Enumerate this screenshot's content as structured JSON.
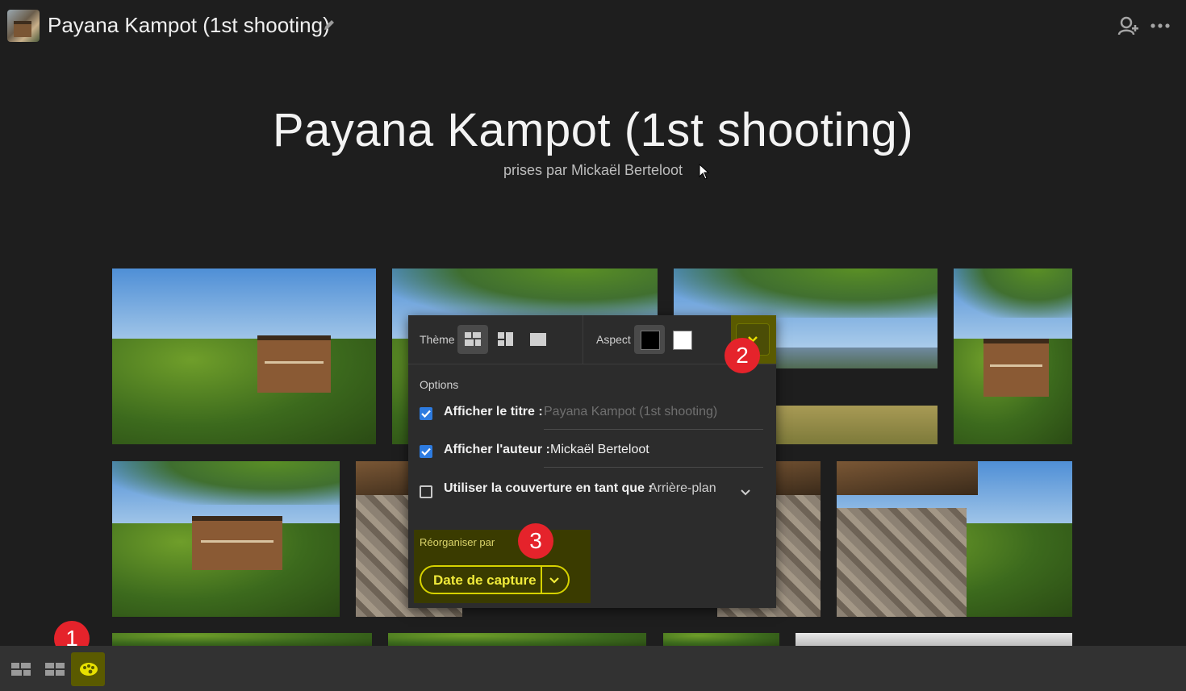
{
  "header": {
    "album_title": "Payana Kampot (1st shooting)",
    "edit_icon": "pencil-icon",
    "share_icon": "add-person-icon",
    "more_icon": "more-icon"
  },
  "hero": {
    "title": "Payana Kampot (1st shooting)",
    "subtitle": "prises par Mickaël Berteloot"
  },
  "popup": {
    "theme_label": "Thème",
    "aspect_label": "Aspect",
    "aspect_options": [
      {
        "name": "black",
        "color": "#000000"
      },
      {
        "name": "white",
        "color": "#ffffff"
      }
    ],
    "options_label": "Options",
    "show_title_label": "Afficher le titre :",
    "show_title_placeholder": "Payana Kampot (1st shooting)",
    "show_author_label": "Afficher l'auteur :",
    "show_author_value": "Mickaël Berteloot",
    "cover_label": "Utiliser la couverture en tant que :",
    "cover_value": "Arrière-plan",
    "reorganize_label": "Réorganiser par",
    "reorganize_value": "Date de capture"
  },
  "badges": [
    "1",
    "2",
    "3"
  ],
  "colors": {
    "accent_yellow": "#d6d200",
    "highlight_bg": "#5a5a00",
    "badge_red": "#e5232b",
    "checkbox_blue": "#2d7be0"
  }
}
